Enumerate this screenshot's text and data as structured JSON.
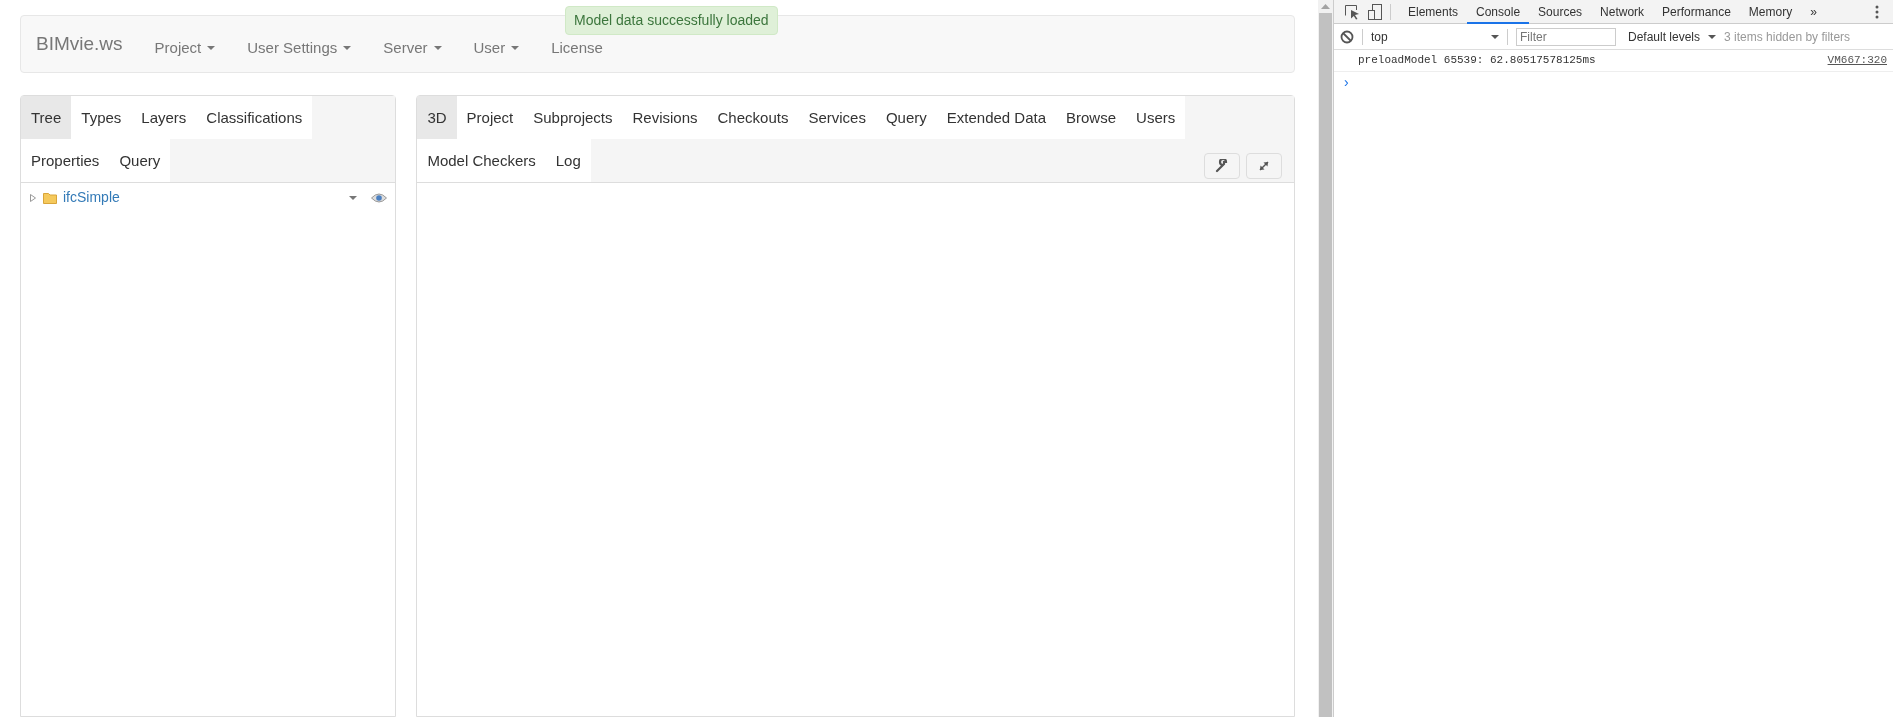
{
  "navbar": {
    "brand": "BIMvie.ws",
    "menus": [
      {
        "label": "Project",
        "dropdown": true
      },
      {
        "label": "User Settings",
        "dropdown": true
      },
      {
        "label": "Server",
        "dropdown": true
      },
      {
        "label": "User",
        "dropdown": true
      },
      {
        "label": "License",
        "dropdown": false
      }
    ]
  },
  "toast": {
    "message": "Model data successfully loaded"
  },
  "left_panel": {
    "tabs": [
      {
        "label": "Tree",
        "selected": true
      },
      {
        "label": "Types",
        "selected": false
      },
      {
        "label": "Layers",
        "selected": false
      },
      {
        "label": "Classifications",
        "selected": false
      },
      {
        "label": "Properties",
        "selected": false
      },
      {
        "label": "Query",
        "selected": false
      }
    ],
    "tree": [
      {
        "label": "ifcSimple",
        "expanded": false
      }
    ]
  },
  "right_panel": {
    "tabs": [
      {
        "label": "3D",
        "selected": true
      },
      {
        "label": "Project",
        "selected": false
      },
      {
        "label": "Subprojects",
        "selected": false
      },
      {
        "label": "Revisions",
        "selected": false
      },
      {
        "label": "Checkouts",
        "selected": false
      },
      {
        "label": "Services",
        "selected": false
      },
      {
        "label": "Query",
        "selected": false
      },
      {
        "label": "Extended Data",
        "selected": false
      },
      {
        "label": "Browse",
        "selected": false
      },
      {
        "label": "Users",
        "selected": false
      },
      {
        "label": "Model Checkers",
        "selected": false
      },
      {
        "label": "Log",
        "selected": false
      }
    ]
  },
  "devtools": {
    "tabs": [
      {
        "label": "Elements",
        "selected": false
      },
      {
        "label": "Console",
        "selected": true
      },
      {
        "label": "Sources",
        "selected": false
      },
      {
        "label": "Network",
        "selected": false
      },
      {
        "label": "Performance",
        "selected": false
      },
      {
        "label": "Memory",
        "selected": false
      }
    ],
    "more": "»",
    "context": "top",
    "filter_placeholder": "Filter",
    "levels": "Default levels",
    "hidden_note": "3 items hidden by filters",
    "messages": [
      {
        "text": "preloadModel 65539: 62.80517578125ms",
        "source": "VM667:320"
      }
    ],
    "prompt": "›"
  }
}
